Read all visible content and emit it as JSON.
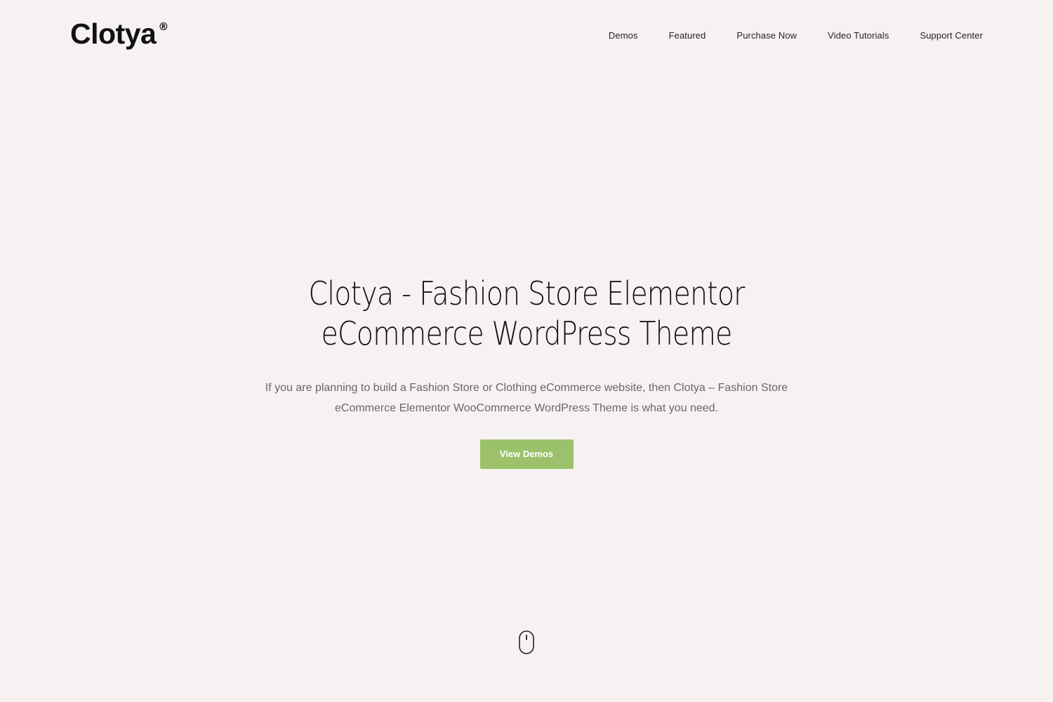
{
  "header": {
    "logo_text": "Clotya",
    "logo_mark": "®",
    "nav": [
      {
        "label": "Demos"
      },
      {
        "label": "Featured"
      },
      {
        "label": "Purchase Now"
      },
      {
        "label": "Video Tutorials"
      },
      {
        "label": "Support Center"
      }
    ]
  },
  "hero": {
    "title_line1": "Clotya - Fashion Store Elementor",
    "title_line2": "eCommerce WordPress Theme",
    "subtitle_line1": "If you are planning to build a Fashion Store or Clothing eCommerce website, then Clotya – Fashion Store",
    "subtitle_line2": "eCommerce Elementor WooCommerce WordPress Theme is what you need.",
    "cta_label": "View Demos"
  },
  "scroll_indicator": {
    "icon": "mouse-icon"
  },
  "colors": {
    "background": "#f7f2f2",
    "accent": "#9bc26a",
    "text": "#141414",
    "muted_text": "#6a6666"
  }
}
